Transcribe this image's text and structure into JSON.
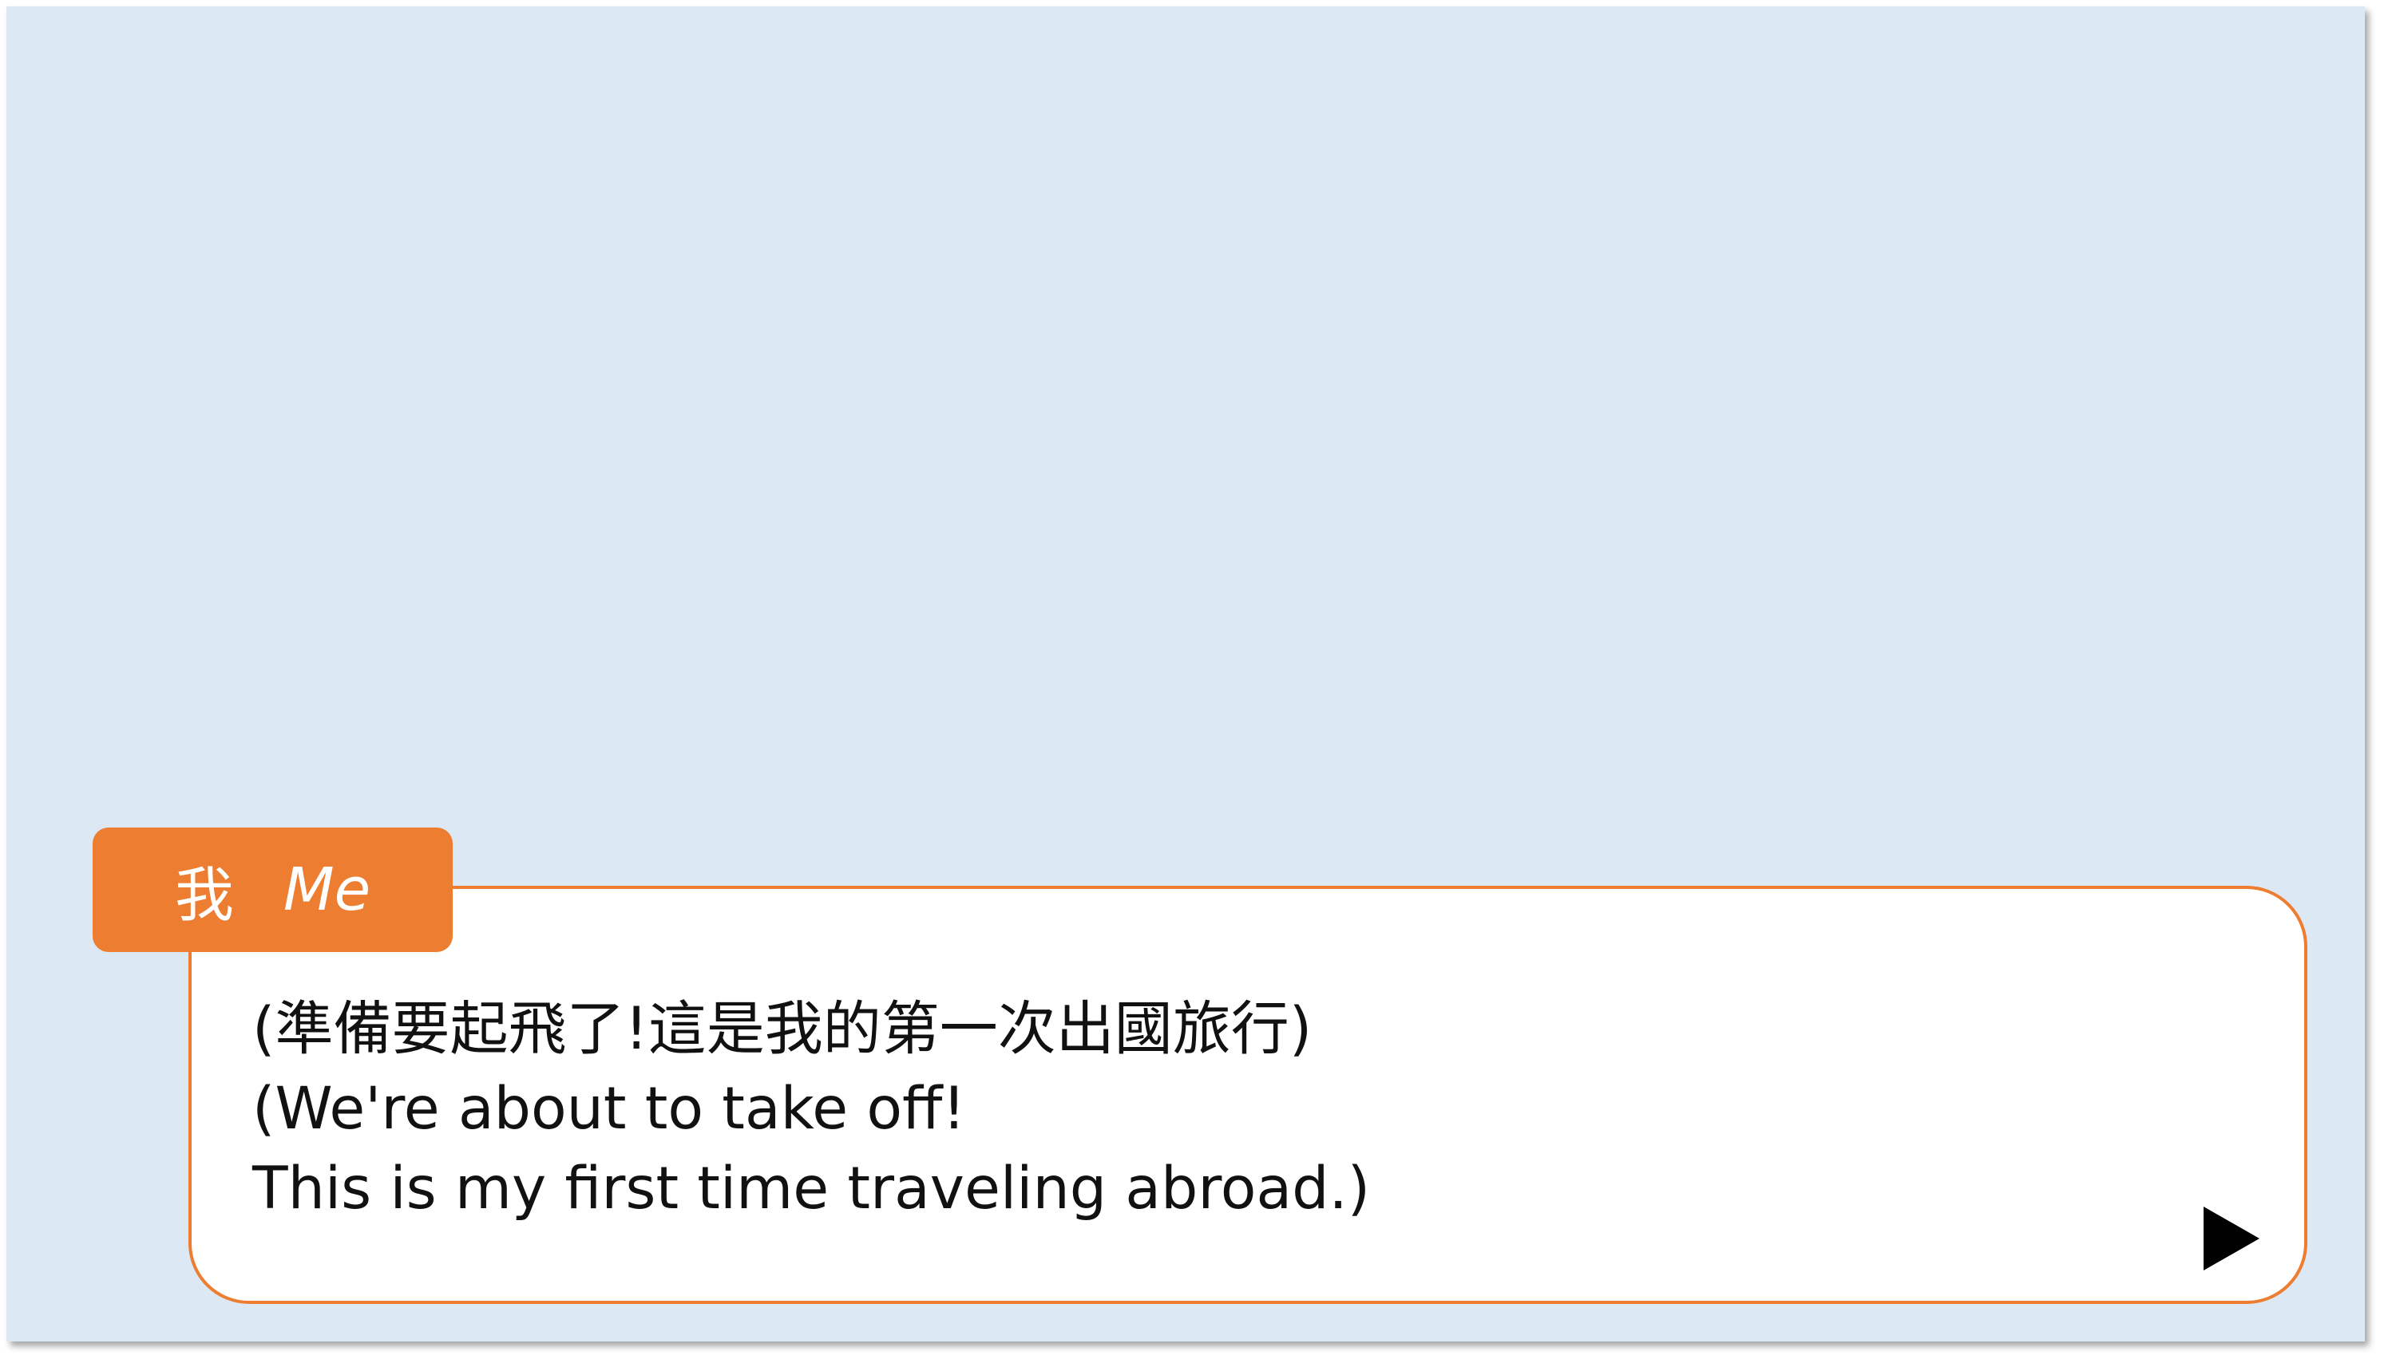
{
  "scene": {
    "background_color": "#dde8f5"
  },
  "speaker": {
    "name_zh": "我",
    "name_en": "Me",
    "tag_color": "#ed7d31"
  },
  "dialogue": {
    "lines": [
      "(準備要起飛了!這是我的第一次出國旅行)",
      "(We're about to take off!",
      "This is my first time traveling abroad.)"
    ],
    "border_color": "#ed7d31"
  },
  "controls": {
    "next_icon": "play-triangle-icon"
  }
}
